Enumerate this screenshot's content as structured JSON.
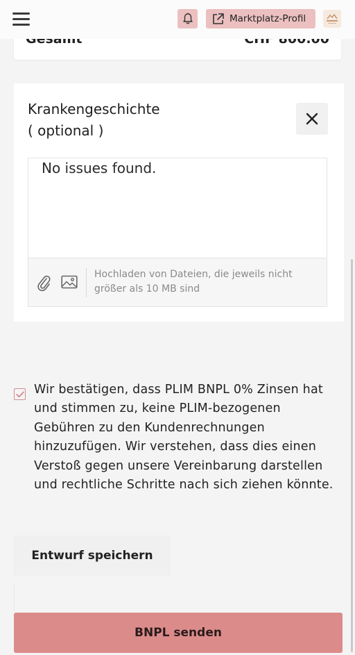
{
  "header": {
    "menu_icon": "hamburger-icon",
    "notification_icon": "bell-icon",
    "marketplace_label": "Marktplatz-Profil",
    "marketplace_icon": "external-link-icon",
    "avatar_icon": "brand-logo",
    "accent_color": "#ecc0c0"
  },
  "summary": {
    "total_label": "Gesamt",
    "total_value": "CHF 800.00"
  },
  "medical_history": {
    "title_line1": "Krankengeschichte",
    "title_line2": "( optional )",
    "close_icon": "close-icon",
    "text_value": "No issues found.",
    "attach_icon": "paperclip-icon",
    "image_icon": "image-icon",
    "upload_hint": "Hochladen von Dateien, die jeweils nicht größer als 10 MB sind"
  },
  "agreement": {
    "checked": true,
    "text": "Wir bestätigen, dass PLIM BNPL 0% Zinsen hat und stimmen zu, keine PLIM-bezogenen Gebühren zu den Kundenrechnungen hinzuzufügen. Wir verstehen, dass dies einen Verstoß gegen unsere Vereinbarung darstellen und rechtliche Schritte nach sich ziehen könnte."
  },
  "actions": {
    "draft_label": "Entwurf speichern",
    "send_label": "BNPL senden",
    "send_color": "#dc8b8b"
  }
}
